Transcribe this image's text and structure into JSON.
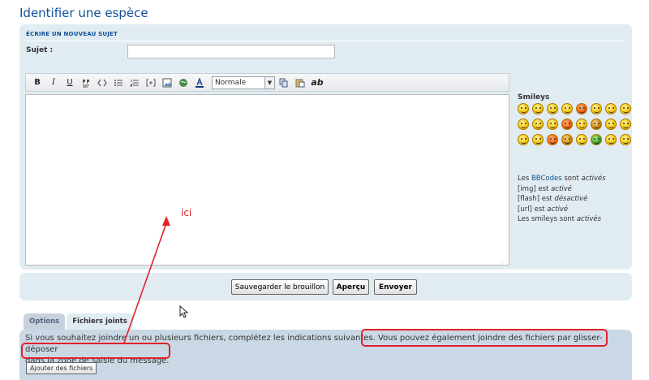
{
  "page": {
    "title": "Identifier une espèce"
  },
  "form": {
    "section_title": "ÉCRIRE UN NOUVEAU SUJET",
    "subject_label": "Sujet :",
    "subject_value": "",
    "font_size_select": "Normale"
  },
  "toolbar": {
    "bold": "B",
    "italic": "I",
    "underline": "U",
    "abc": "ab"
  },
  "smileys": {
    "title": "Smileys",
    "count": 24
  },
  "bbcode_info": {
    "line1_prefix": "Les ",
    "line1_link": "BBCodes",
    "line1_mid": " sont ",
    "line1_state": "activés",
    "line2_tag": "[img]",
    "line2_mid": " est ",
    "line2_state": "activé",
    "line3_tag": "[flash]",
    "line3_mid": " est ",
    "line3_state": "désactivé",
    "line4_tag": "[url]",
    "line4_mid": " est ",
    "line4_state": "activé",
    "line5_prefix": "Les smileys sont ",
    "line5_state": "activés"
  },
  "buttons": {
    "save_draft": "Sauvegarder le brouillon",
    "preview": "Aperçu",
    "submit": "Envoyer"
  },
  "tabs": {
    "options": "Options",
    "attachments": "Fichiers joints"
  },
  "attachments": {
    "help_text_part1": "Si vous souhaitez joindre un ou plusieurs fichiers, complétez les indications suivantes. ",
    "help_text_part2": "Vous pouvez également joindre des fichiers par glisser-déposer",
    "help_text_part3": "dans la zone de saisie du message.",
    "add_files_button": "Ajouter des fichiers"
  },
  "annotation": {
    "label": "ici",
    "color": "#e0222a"
  }
}
